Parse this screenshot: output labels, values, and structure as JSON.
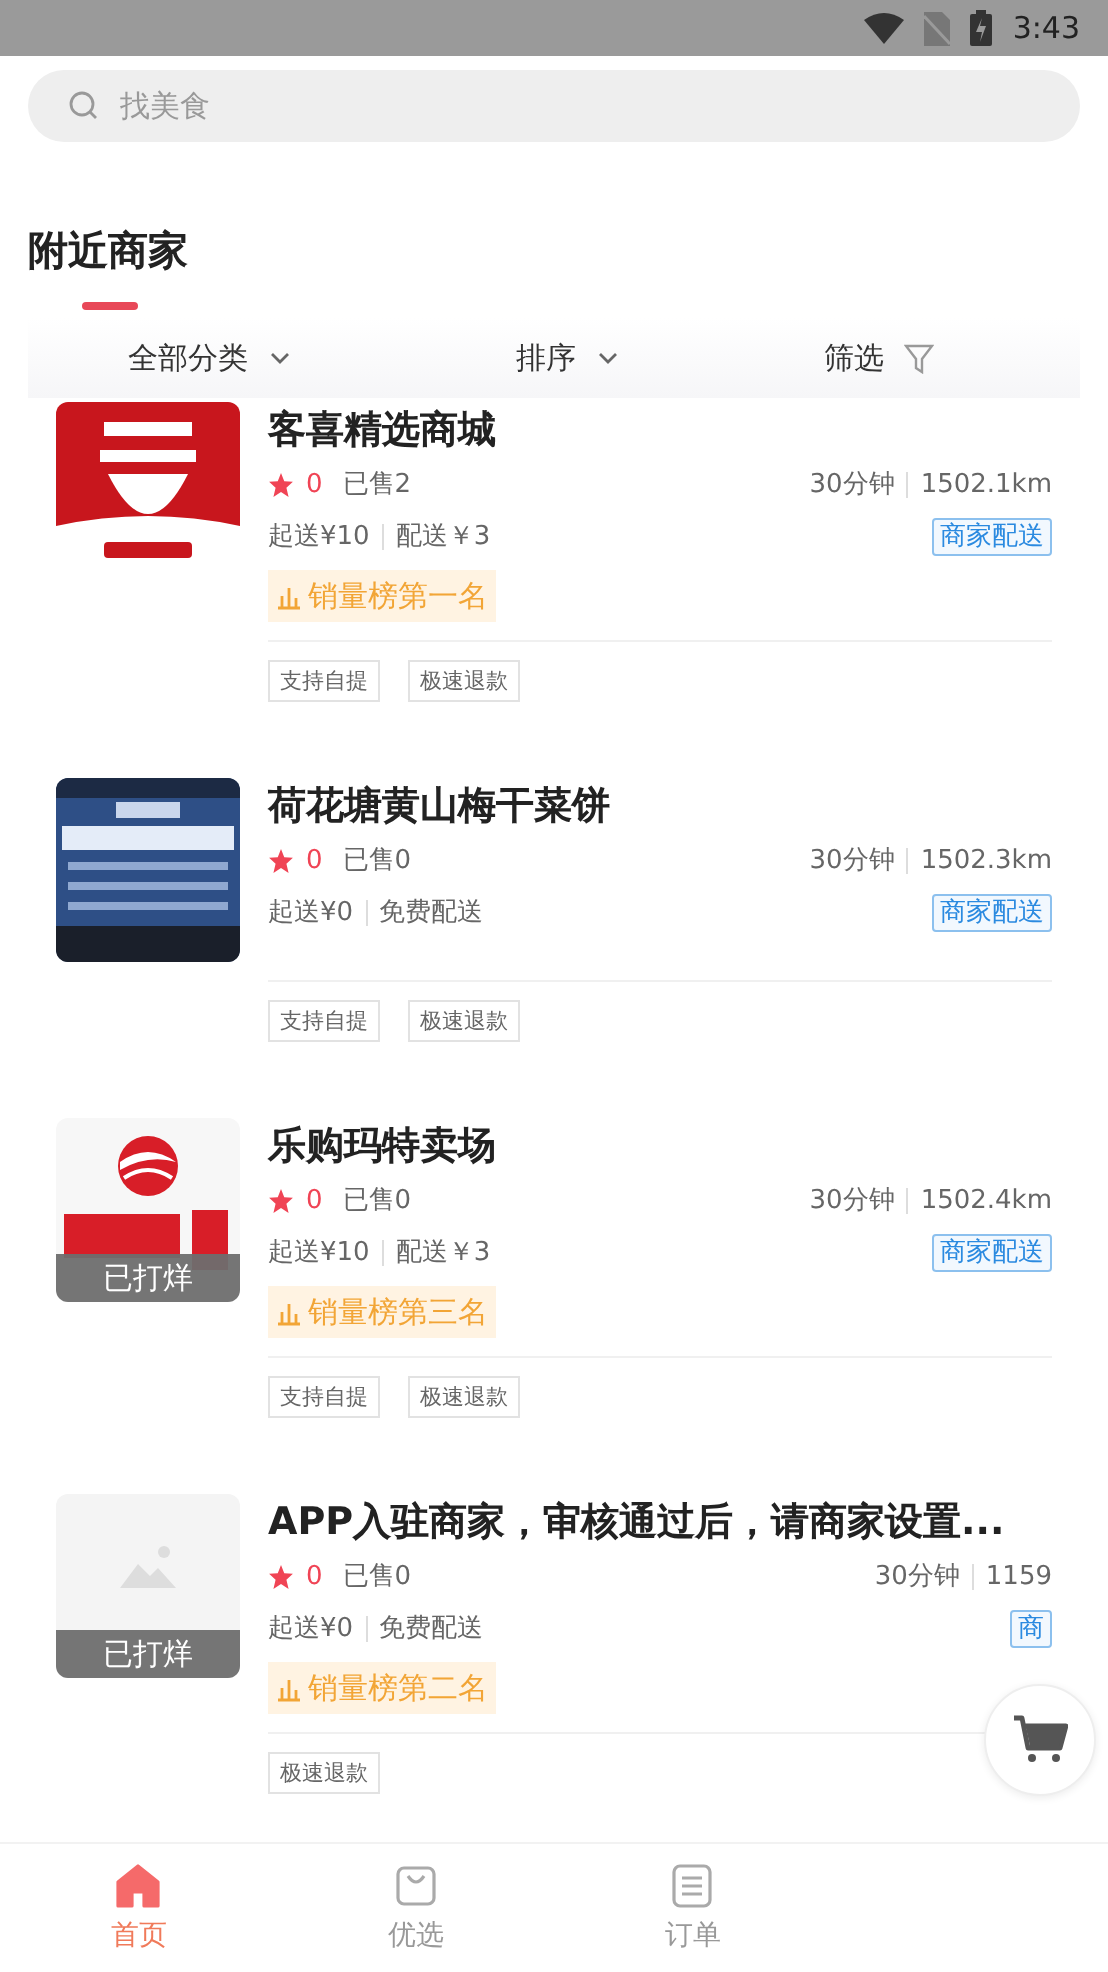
{
  "status_bar": {
    "time": "3:43"
  },
  "search": {
    "placeholder": "找美食"
  },
  "section": {
    "title": "附近商家"
  },
  "filters": [
    {
      "label": "全部分类",
      "kind": "dropdown"
    },
    {
      "label": "排序",
      "kind": "dropdown"
    },
    {
      "label": "筛选",
      "kind": "filter"
    }
  ],
  "stores": [
    {
      "name": "客喜精选商城",
      "image": {
        "kind": "picture"
      },
      "rating": "0",
      "sold": "已售2",
      "time": "30分钟",
      "distance": "1502.1km",
      "min_order": "起送¥10",
      "delivery_fee": "配送￥3",
      "delivery_badge": "商家配送",
      "rank": "销量榜第一名",
      "tags": [
        "支持自提",
        "极速退款"
      ]
    },
    {
      "name": "荷花塘黄山梅干菜饼",
      "image": {
        "kind": "picture"
      },
      "rating": "0",
      "sold": "已售0",
      "time": "30分钟",
      "distance": "1502.3km",
      "min_order": "起送¥0",
      "delivery_fee": "免费配送",
      "delivery_badge": "商家配送",
      "tags": [
        "支持自提",
        "极速退款"
      ]
    },
    {
      "name": "乐购玛特卖场",
      "image": {
        "kind": "picture"
      },
      "status_label": "已打烊",
      "rating": "0",
      "sold": "已售0",
      "time": "30分钟",
      "distance": "1502.4km",
      "min_order": "起送¥10",
      "delivery_fee": "配送￥3",
      "delivery_badge": "商家配送",
      "rank": "销量榜第三名",
      "tags": [
        "支持自提",
        "极速退款"
      ]
    },
    {
      "name": "APP入驻商家，审核通过后，请商家设置...",
      "image": {
        "kind": "placeholder"
      },
      "status_label": "已打烊",
      "rating": "0",
      "sold": "已售0",
      "time": "30分钟",
      "distance": "1159",
      "min_order": "起送¥0",
      "delivery_fee": "免费配送",
      "delivery_badge": "商",
      "rank": "销量榜第二名",
      "tags": [
        "极速退款"
      ]
    }
  ],
  "bottom_nav": [
    {
      "label": "首页",
      "kind": "home",
      "selected": true
    },
    {
      "label": "优选",
      "kind": "shop",
      "selected": false
    },
    {
      "label": "订单",
      "kind": "orders",
      "selected": false
    }
  ]
}
